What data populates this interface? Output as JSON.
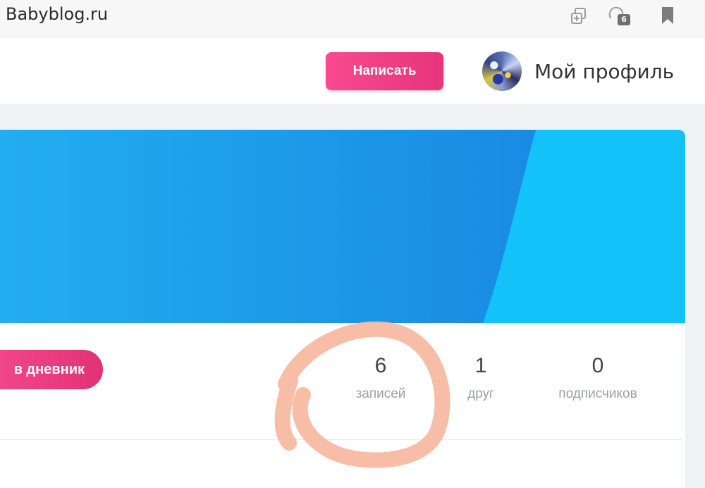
{
  "browser": {
    "url": "Babyblog.ru",
    "tab_count_badge": "6",
    "icons": [
      "open-tab-icon",
      "tabs-count-icon",
      "bookmark-icon"
    ]
  },
  "header": {
    "write_label": "Написать",
    "profile_label": "Мой профиль"
  },
  "profile": {
    "diary_button_label": "в дневник",
    "stats": [
      {
        "value": "6",
        "label": "записей"
      },
      {
        "value": "1",
        "label": "друг"
      },
      {
        "value": "0",
        "label": "подписчиков"
      }
    ]
  },
  "colors": {
    "accent_pink": "#f0457f",
    "banner_blue": "#1b95e6",
    "annotation": "#f6b8a0"
  }
}
